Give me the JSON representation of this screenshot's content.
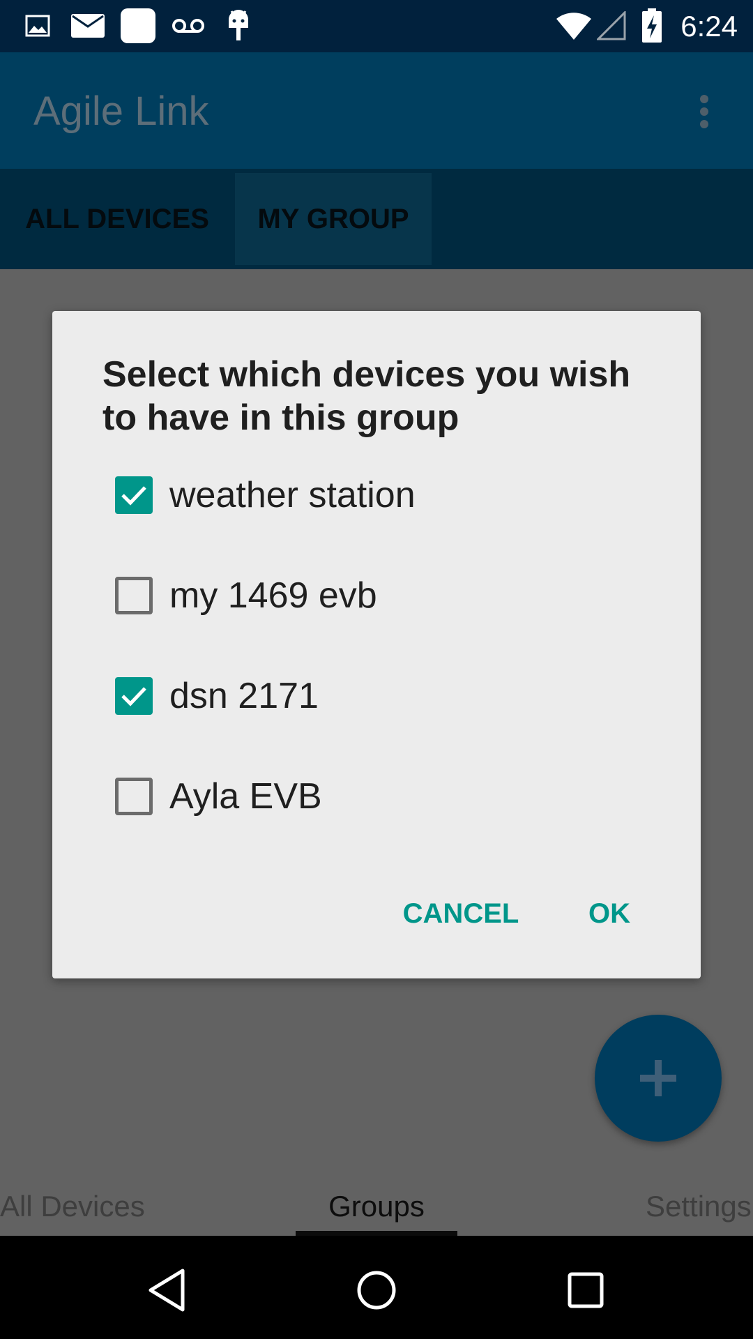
{
  "status_bar": {
    "time": "6:24",
    "left_icons": [
      "image-icon",
      "mail-icon",
      "square-app-icon",
      "voicemail-icon",
      "android-debug-icon"
    ],
    "right_icons": [
      "wifi-icon",
      "signal-icon",
      "battery-charging-icon"
    ]
  },
  "app_bar": {
    "title": "Agile Link",
    "menu_icon": "overflow-menu-icon"
  },
  "tabs": [
    {
      "label": "ALL DEVICES",
      "selected": false
    },
    {
      "label": "MY GROUP",
      "selected": true
    }
  ],
  "dialog": {
    "title": "Select which devices you wish to have in this group",
    "items": [
      {
        "label": "weather station",
        "checked": true
      },
      {
        "label": "my 1469 evb",
        "checked": false
      },
      {
        "label": "dsn 2171",
        "checked": true
      },
      {
        "label": "Ayla EVB",
        "checked": false
      }
    ],
    "cancel_label": "CANCEL",
    "ok_label": "OK"
  },
  "fab": {
    "icon": "plus-icon"
  },
  "bottom_nav": {
    "items": [
      {
        "label": "All Devices",
        "selected": false
      },
      {
        "label": "Groups",
        "selected": true
      },
      {
        "label": "Settings",
        "selected": false
      }
    ]
  },
  "system_nav": {
    "icons": [
      "back-icon",
      "home-icon",
      "recents-icon"
    ]
  },
  "colors": {
    "status_bar": "#01213d",
    "app_bar": "#003e5e",
    "accent": "#00968a",
    "fab": "#003d5e",
    "scrim": "#626262"
  }
}
